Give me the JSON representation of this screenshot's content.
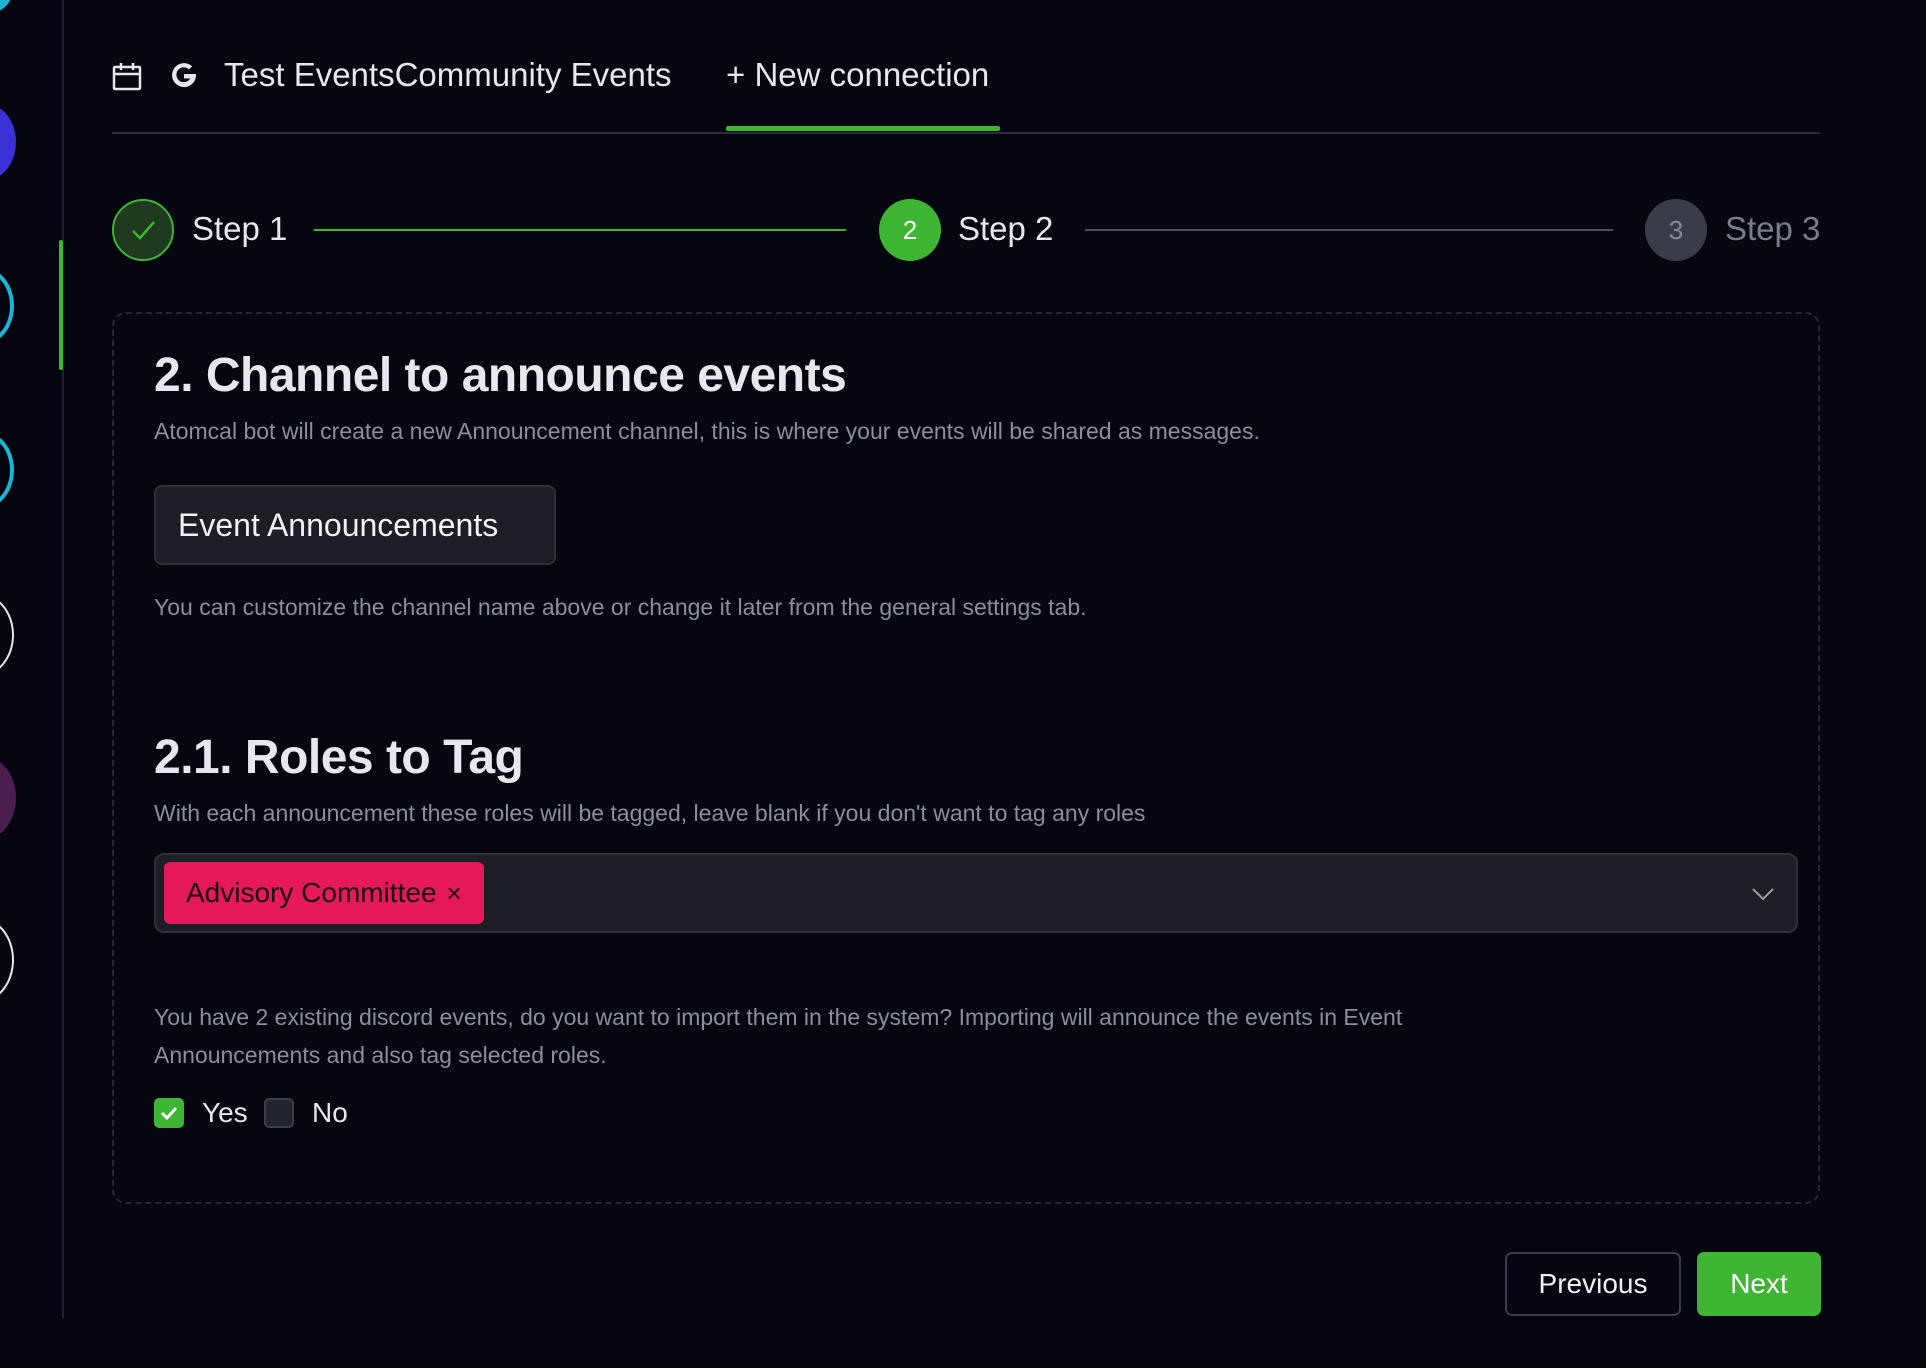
{
  "header": {
    "tab_title": "Test EventsCommunity Events",
    "new_connection_label": "+ New connection"
  },
  "stepper": {
    "steps": [
      {
        "label": "Step 1",
        "number": "1",
        "status": "completed"
      },
      {
        "label": "Step 2",
        "number": "2",
        "status": "active"
      },
      {
        "label": "Step 3",
        "number": "3",
        "status": "upcoming"
      }
    ]
  },
  "channel_section": {
    "title": "2. Channel to announce events",
    "description": "Atomcal bot will create a new Announcement channel, this is where your events will be shared as messages.",
    "channel_name_value": "Event Announcements",
    "hint": "You can customize the channel name above or change it later from the general settings tab."
  },
  "roles_section": {
    "title": "2.1. Roles to Tag",
    "description": "With each announcement these roles will be tagged, leave blank if you don't want to tag any roles",
    "selected_roles": [
      {
        "label": "Advisory Committee",
        "color": "#e5185a"
      }
    ]
  },
  "import_section": {
    "text": "You have 2 existing discord events, do you want to import them in the system? Importing will announce the events in Event Announcements and also tag selected roles.",
    "yes_label": "Yes",
    "yes_checked": true,
    "no_label": "No",
    "no_checked": false
  },
  "buttons": {
    "previous_label": "Previous",
    "next_label": "Next"
  },
  "colors": {
    "accent": "#3fb534",
    "background": "#05060f",
    "role_tag": "#e5185a"
  },
  "icons": [
    "calendar-icon",
    "google-icon",
    "check-icon",
    "close-icon",
    "chevron-down-icon"
  ]
}
